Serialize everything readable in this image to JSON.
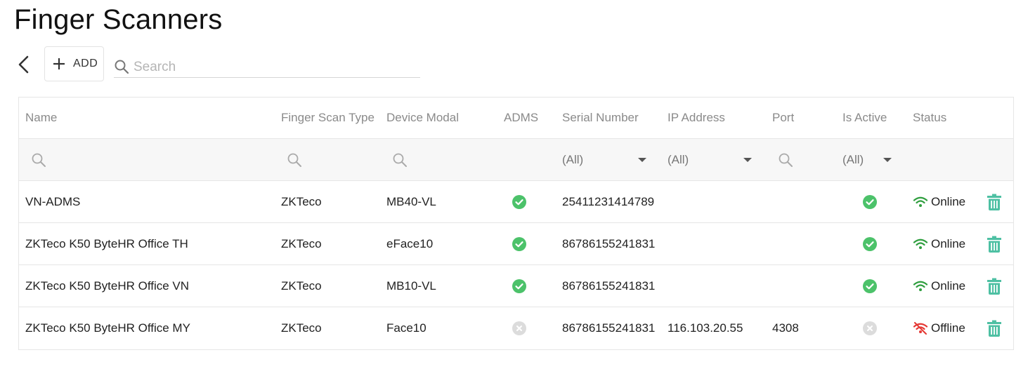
{
  "page": {
    "title": "Finger Scanners"
  },
  "toolbar": {
    "back_icon": "chevron-left-icon",
    "add_icon": "plus-icon",
    "add_label": "ADD",
    "search_placeholder": "Search",
    "search_value": ""
  },
  "table": {
    "columns": [
      "Name",
      "Finger Scan Type",
      "Device Modal",
      "ADMS",
      "Serial Number",
      "IP Address",
      "Port",
      "Is Active",
      "Status"
    ],
    "filters": {
      "serial_number": "(All)",
      "ip_address": "(All)",
      "is_active": "(All)"
    },
    "rows": [
      {
        "name": "VN-ADMS",
        "type": "ZKTeco",
        "modal": "MB40-VL",
        "adms": true,
        "serial": "25411231414789",
        "ip": "",
        "port": "",
        "active": true,
        "status": "Online"
      },
      {
        "name": "ZKTeco K50 ByteHR Office TH",
        "type": "ZKTeco",
        "modal": "eFace10",
        "adms": true,
        "serial": "86786155241831",
        "ip": "",
        "port": "",
        "active": true,
        "status": "Online"
      },
      {
        "name": "ZKTeco K50 ByteHR Office VN",
        "type": "ZKTeco",
        "modal": "MB10-VL",
        "adms": true,
        "serial": "86786155241831",
        "ip": "",
        "port": "",
        "active": true,
        "status": "Online"
      },
      {
        "name": "ZKTeco K50 ByteHR Office MY",
        "type": "ZKTeco",
        "modal": "Face10",
        "adms": false,
        "serial": "86786155241831",
        "ip": "116.103.20.55",
        "port": "4308",
        "active": false,
        "status": "Offline"
      }
    ]
  },
  "colors": {
    "check_green": "#4cc26a",
    "disabled_gray": "#d9d9d9",
    "online_green": "#2e9e3e",
    "offline_red": "#e53935",
    "trash_teal": "#4ec0a3",
    "header_text": "#8a8a8a"
  }
}
